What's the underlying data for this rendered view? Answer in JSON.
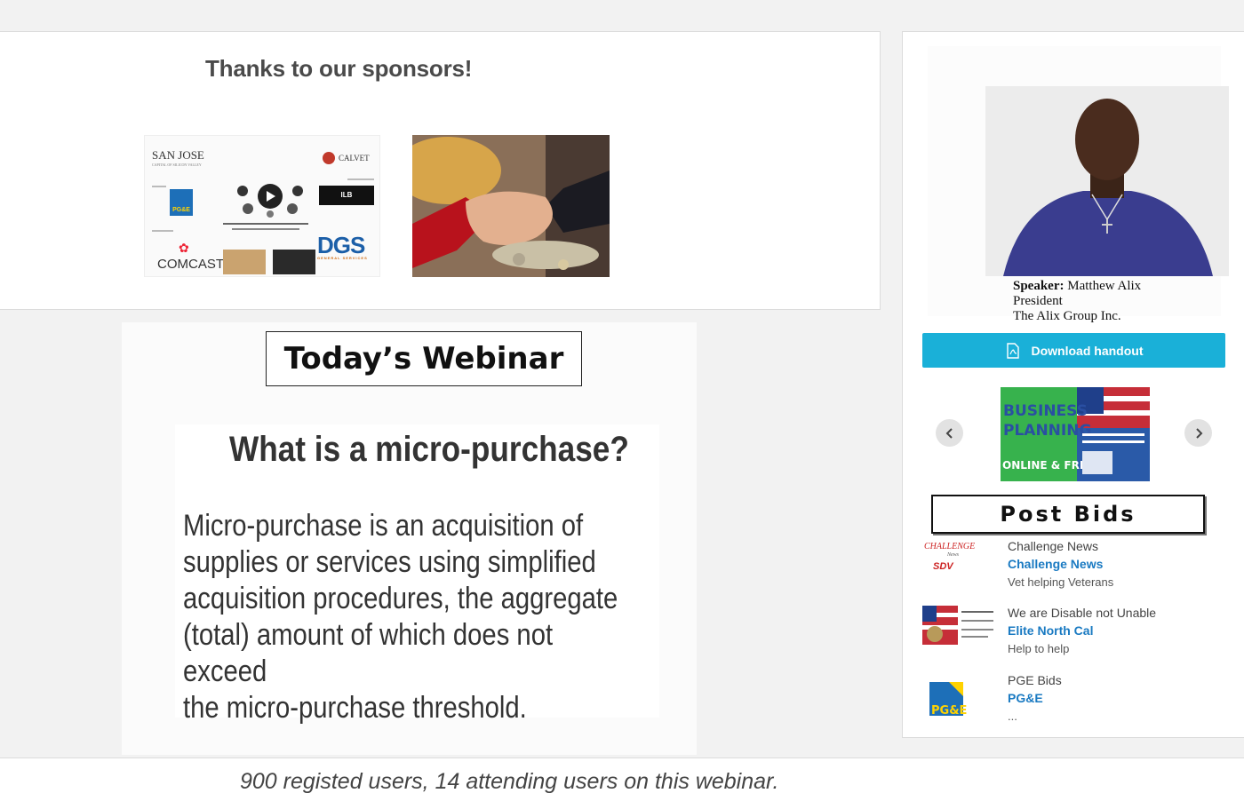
{
  "sponsors": {
    "heading": "Thanks to our sponsors!",
    "collage": {
      "san_jose": "SAN JOSE",
      "calvet": "CALVET",
      "ilb": "ILB",
      "comcast": "COMCAST",
      "dgs": "DGS",
      "pge": "PG&E"
    }
  },
  "speaker": {
    "label": "Speaker:",
    "name": "Matthew Alix",
    "title": "President",
    "company": "The Alix Group Inc."
  },
  "download": {
    "label": "Download handout"
  },
  "carousel": {
    "banner_line1": "BUSINESS",
    "banner_line2": "PLANNING",
    "banner_line3": "ONLINE & FREE"
  },
  "post_bids": {
    "label": "Post Bids"
  },
  "ads": [
    {
      "title": "Challenge News",
      "link": "Challenge News",
      "desc": "Vet helping Veterans",
      "logo_text": "CHALLENGE"
    },
    {
      "title": "We are Disable not Unable",
      "link": "Elite North Cal",
      "desc": "Help to help"
    },
    {
      "title": "PGE Bids",
      "link": "PG&E",
      "desc": "...",
      "logo_text": "PG&E"
    }
  ],
  "slide": {
    "heading": "Today’s Webinar",
    "question": "What is a micro-purchase?",
    "body_lines": [
      "Micro-purchase is an acquisition of",
      "supplies or services using simplified",
      "acquisition procedures, the aggregate",
      "(total) amount of which does not exceed",
      "the micro-purchase threshold."
    ]
  },
  "footer": {
    "text": "900 registed users, 14 attending users on this webinar."
  },
  "colors": {
    "accent": "#1ab0d8",
    "link": "#1a7ac2",
    "background": "#f2f2f2"
  }
}
